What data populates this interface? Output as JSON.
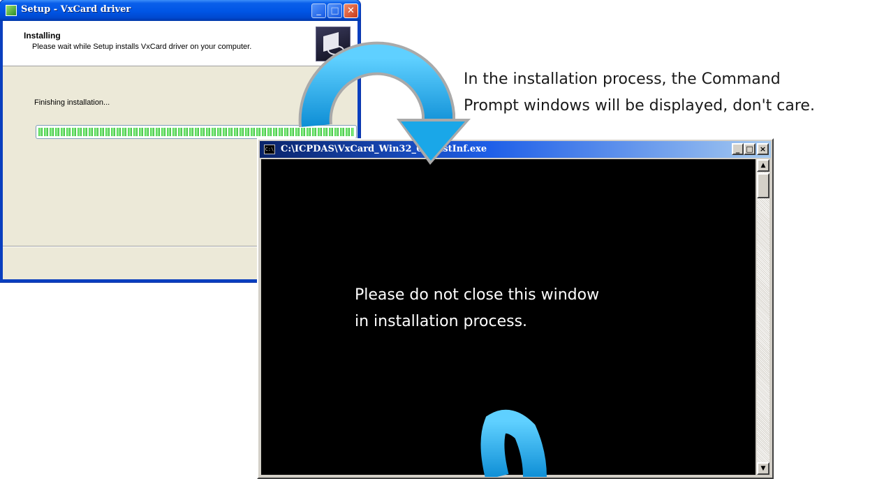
{
  "setup_window": {
    "title": "Setup - VxCard driver",
    "heading": "Installing",
    "subheading": "Please wait while Setup installs VxCard driver on your computer.",
    "status": "Finishing installation...",
    "progress_percent": 100,
    "buttons": {
      "minimize": "_",
      "maximize": "□",
      "close": "✕"
    },
    "icons": {
      "title": "setup-icon",
      "logo": "installer-logo-icon"
    }
  },
  "cmd_window": {
    "title": "C:\\ICPDAS\\VxCard_Win32_64\\InstInf.exe",
    "icon_label": "C:\\",
    "message_line1": "Please do not close this window",
    "message_line2": "in installation process.",
    "buttons": {
      "minimize": "_",
      "maximize": "□",
      "close": "×"
    },
    "scroll_up": "▲",
    "scroll_down": "▼"
  },
  "annotation": {
    "line1": "In the installation process, the Command",
    "line2": "Prompt windows will be displayed, don't care."
  },
  "colors": {
    "xp_title": "#0055e5",
    "arrow_blue": "#1aa7e8",
    "progress_green": "#3fd23f",
    "console_bg": "#000000"
  }
}
